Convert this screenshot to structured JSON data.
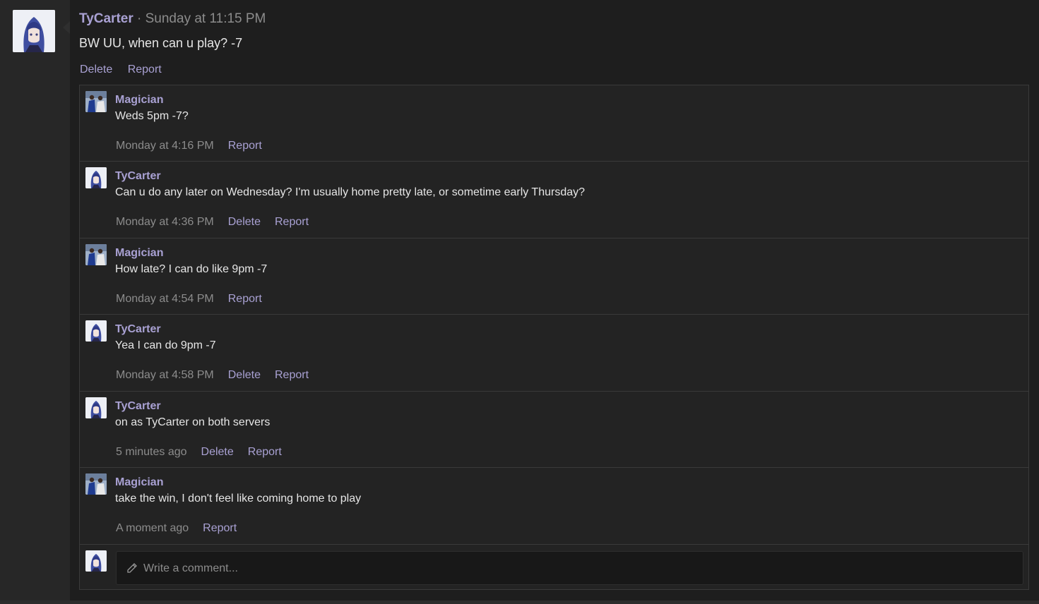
{
  "post": {
    "author": "TyCarter",
    "separator": " · ",
    "timestamp": "Sunday at 11:15 PM",
    "body": "BW UU, when can u play? -7",
    "actions": {
      "delete": "Delete",
      "report": "Report"
    }
  },
  "comments": [
    {
      "author": "Magician",
      "avatar": "magician-avatar",
      "text": "Weds 5pm -7?",
      "time": "Monday at 4:16 PM",
      "actions": [
        "Report"
      ]
    },
    {
      "author": "TyCarter",
      "avatar": "tycarter-avatar",
      "text": "Can u do any later on Wednesday? I'm usually home pretty late, or sometime early Thursday?",
      "time": "Monday at 4:36 PM",
      "actions": [
        "Delete",
        "Report"
      ]
    },
    {
      "author": "Magician",
      "avatar": "magician-avatar",
      "text": "How late? I can do like 9pm -7",
      "time": "Monday at 4:54 PM",
      "actions": [
        "Report"
      ]
    },
    {
      "author": "TyCarter",
      "avatar": "tycarter-avatar",
      "text": "Yea I can do 9pm -7",
      "time": "Monday at 4:58 PM",
      "actions": [
        "Delete",
        "Report"
      ]
    },
    {
      "author": "TyCarter",
      "avatar": "tycarter-avatar",
      "text": "on as TyCarter on both servers",
      "time": "5 minutes ago",
      "actions": [
        "Delete",
        "Report"
      ]
    },
    {
      "author": "Magician",
      "avatar": "magician-avatar",
      "text": "take the win, I don't feel like coming home to play",
      "time": "A moment ago",
      "actions": [
        "Report"
      ]
    }
  ],
  "composer": {
    "placeholder": "Write a comment...",
    "icon": "pencil-icon"
  },
  "colors": {
    "accent": "#a9a1d3",
    "text": "#e6e6e6",
    "muted": "#8c8c8c",
    "background": "#1e1e1e"
  }
}
